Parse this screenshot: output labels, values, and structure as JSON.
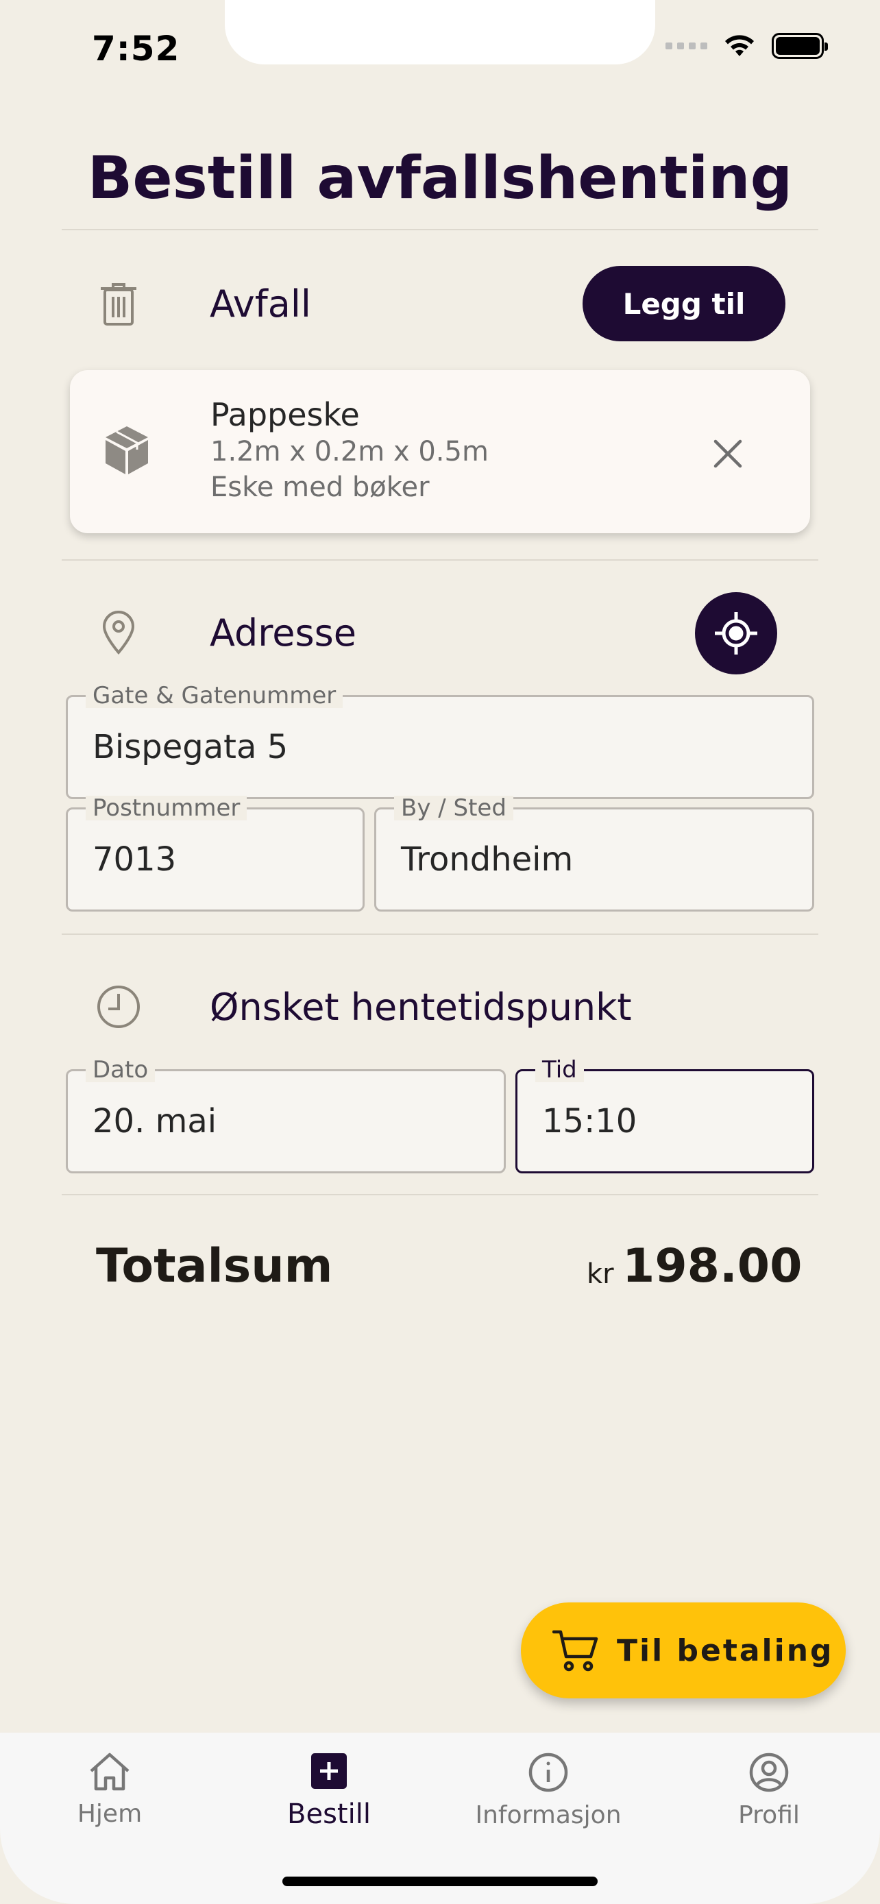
{
  "status_bar": {
    "time": "7:52"
  },
  "page": {
    "title": "Bestill avfallshenting"
  },
  "waste": {
    "label": "Avfall",
    "add_button": "Legg til",
    "items": [
      {
        "name": "Pappeske",
        "dimensions": "1.2m x 0.2m x 0.5m",
        "description": "Eske med bøker"
      }
    ]
  },
  "address": {
    "label": "Adresse",
    "street": {
      "label": "Gate & Gatenummer",
      "value": "Bispegata 5"
    },
    "postal_code": {
      "label": "Postnummer",
      "value": "7013"
    },
    "city": {
      "label": "By / Sted",
      "value": "Trondheim"
    }
  },
  "pickup_time": {
    "label": "Ønsket hentetidspunkt",
    "date": {
      "label": "Dato",
      "value": "20. mai"
    },
    "time": {
      "label": "Tid",
      "value": "15:10"
    }
  },
  "total": {
    "label": "Totalsum",
    "currency": "kr",
    "amount": "198.00"
  },
  "checkout_button": "Til betaling",
  "nav": [
    {
      "label": "Hjem",
      "icon": "home-icon"
    },
    {
      "label": "Bestill",
      "icon": "add-box-icon",
      "active": true
    },
    {
      "label": "Informasjon",
      "icon": "info-icon"
    },
    {
      "label": "Profil",
      "icon": "account-circle-icon"
    }
  ],
  "colors": {
    "primary": "#1E0B33",
    "accent": "#FFC20A",
    "background": "#F2EEE5"
  }
}
